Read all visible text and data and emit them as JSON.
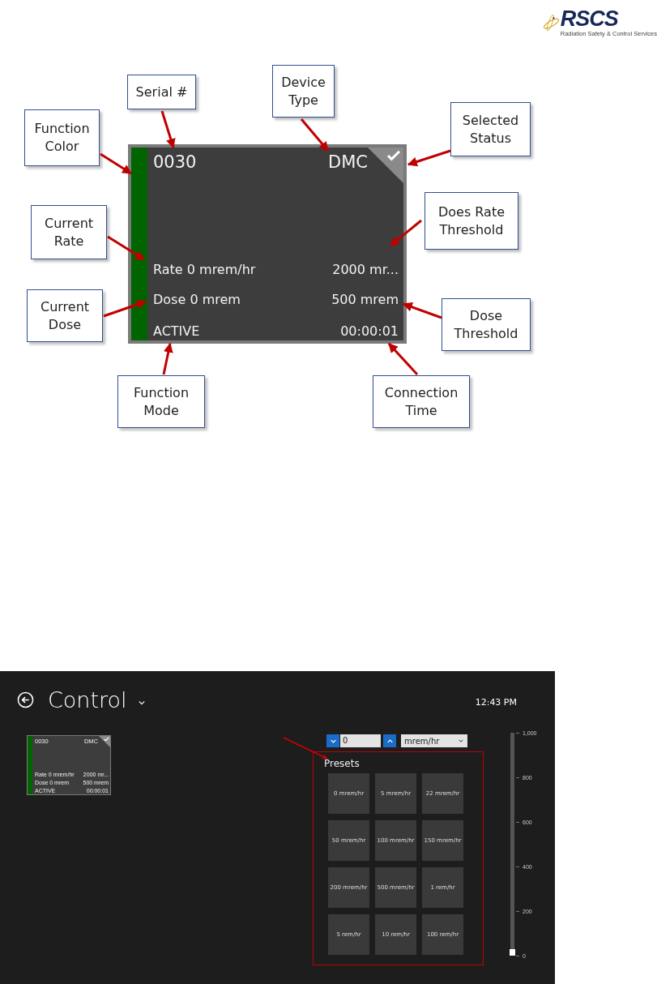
{
  "logo": {
    "name": "RSCS",
    "tagline": "Radiation Safety & Control Services"
  },
  "diagram": {
    "tile": {
      "serial": "0030",
      "device_type": "DMC",
      "selected": true,
      "color": "#006400",
      "rate": "Rate 0 mrem/hr",
      "rate_threshold": "2000 mr...",
      "dose": "Dose 0 mrem",
      "dose_threshold": "500 mrem",
      "mode": "ACTIVE",
      "connection_time": "00:00:01"
    },
    "callouts": [
      {
        "label": "Serial #"
      },
      {
        "label": "Device Type"
      },
      {
        "label": "Function Color"
      },
      {
        "label": "Selected Status"
      },
      {
        "label": "Current Rate"
      },
      {
        "label": "Does Rate Threshold"
      },
      {
        "label": "Current Dose"
      },
      {
        "label": "Dose Threshold"
      },
      {
        "label": "Function Mode"
      },
      {
        "label": "Connection Time"
      }
    ]
  },
  "screen": {
    "title": "Control",
    "time": "12:43 PM",
    "tile": {
      "serial": "0030",
      "device_type": "DMC",
      "selected": true,
      "color": "#006400",
      "rate": "Rate 0 mrem/hr",
      "rate_threshold": "2000 mr...",
      "dose": "Dose 0 mrem",
      "dose_threshold": "500 mrem",
      "mode": "ACTIVE",
      "connection_time": "00:00:01"
    },
    "stepper": {
      "value": "0",
      "unit": "mrem/hr"
    },
    "presets": {
      "title": "Presets",
      "items": [
        "0 mrem/hr",
        "5 mrem/hr",
        "22 mrem/hr",
        "50 mrem/hr",
        "100 mrem/hr",
        "150 mrem/hr",
        "200 mrem/hr",
        "500 mrem/hr",
        "1 rem/hr",
        "5 rem/hr",
        "10 rem/hr",
        "100 rem/hr"
      ]
    },
    "slider": {
      "level": 0,
      "labels": [
        "1,000",
        "800",
        "600",
        "400",
        "200",
        "0"
      ]
    }
  }
}
